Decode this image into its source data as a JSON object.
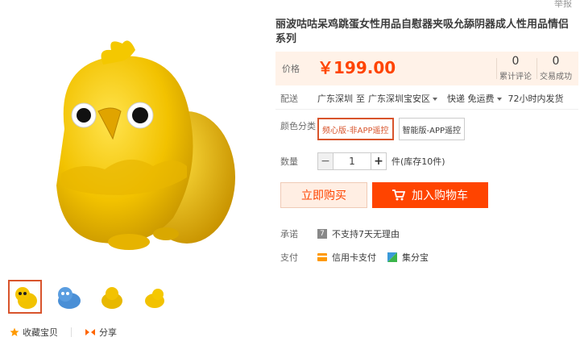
{
  "top": {
    "report_label": "举报"
  },
  "product": {
    "title": "丽波咕咕呆鸡跳蛋女性用品自慰器夹吸允舔阴器成人性用品情侣系列"
  },
  "price": {
    "label": "价格",
    "value": "￥199.00",
    "reviews_count": "0",
    "reviews_label": "累计评论",
    "sales_count": "0",
    "sales_label": "交易成功"
  },
  "shipping": {
    "label": "配送",
    "from": "广东深圳",
    "to_word": "至",
    "to": "广东深圳宝安区",
    "method": "快递 免运费",
    "eta": "72小时内发货"
  },
  "color": {
    "label": "颜色分类",
    "options": [
      "频心版-非APP遥控",
      "智能版-APP遥控"
    ],
    "selected_index": 0
  },
  "quantity": {
    "label": "数量",
    "minus": "−",
    "value": "1",
    "plus": "+",
    "stock": "件(库存10件)"
  },
  "buttons": {
    "buy_now": "立即购买",
    "add_to_cart": "加入购物车"
  },
  "promise": {
    "label": "承诺",
    "badge": "7",
    "text": "不支持7天无理由"
  },
  "payment": {
    "label": "支付",
    "methods": [
      "信用卡支付",
      "集分宝"
    ]
  },
  "gallery": {
    "thumbnails": [
      "yellow-chick-thumb",
      "blue-chick-thumb",
      "yellow-chick-side-thumb",
      "yellow-chick-back-thumb"
    ],
    "selected_index": 0
  },
  "actions": {
    "favorite": "收藏宝贝",
    "share": "分享"
  },
  "colors": {
    "accent": "#ff4400",
    "selected_border": "#d8542c",
    "price_bg": "#fff2e8",
    "chick_yellow": "#f5c400",
    "chick_blue": "#4a8fd6"
  }
}
